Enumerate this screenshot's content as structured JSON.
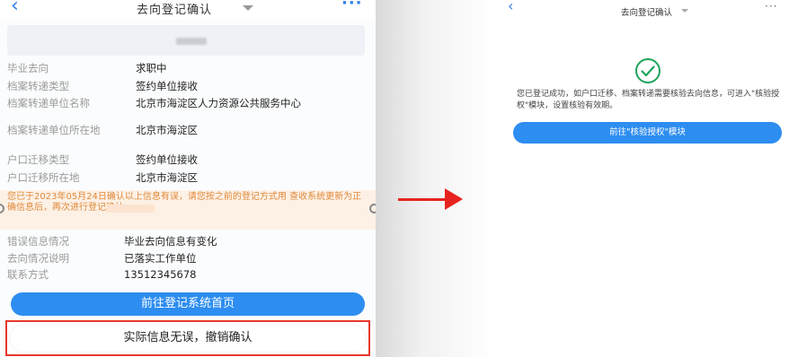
{
  "left": {
    "header": {
      "back_icon": "‹",
      "title": "去向登记确认",
      "more_icon": "···"
    },
    "info": [
      {
        "label": "毕业去向",
        "value": "求职中"
      },
      {
        "label": "档案转递类型",
        "value": "签约单位接收"
      },
      {
        "label": "档案转递单位名称",
        "value": "北京市海淀区人力资源公共服务中心"
      },
      {
        "label": "档案转递单位所在地",
        "value": "北京市海淀区"
      },
      {
        "label": "户口迁移类型",
        "value": "签约单位接收"
      },
      {
        "label": "户口迁移所在地",
        "value": "北京市海淀区"
      }
    ],
    "notice": "您已于2023年05月24日确认以上信息有误，请您按之前的登记方式用                    查收系统更新为正确信息后，再次进行登记确认。",
    "info2": [
      {
        "label": "错误信息情况",
        "value": "毕业去向信息有变化"
      },
      {
        "label": "去向情况说明",
        "value": "已落实工作单位"
      },
      {
        "label": "联系方式",
        "value": "13512345678"
      }
    ],
    "primary_button": "前往登记系统首页",
    "revoke_button": "实际信息无误，撤销确认"
  },
  "right": {
    "header": {
      "back_icon": "‹",
      "title": "去向登记确认",
      "more_icon": "···"
    },
    "message": "您已登记成功，如户口迁移、档案转递需要核验去向信息，可进入\"核验授权\"模块，设置核验有效期。",
    "button": "前往\"核验授权\"模块"
  },
  "colors": {
    "primary": "#2d8df0",
    "highlight_border": "#e8372c",
    "arrow": "#e8231f",
    "notice_text": "#e08a3a",
    "success": "#1fa35c"
  }
}
